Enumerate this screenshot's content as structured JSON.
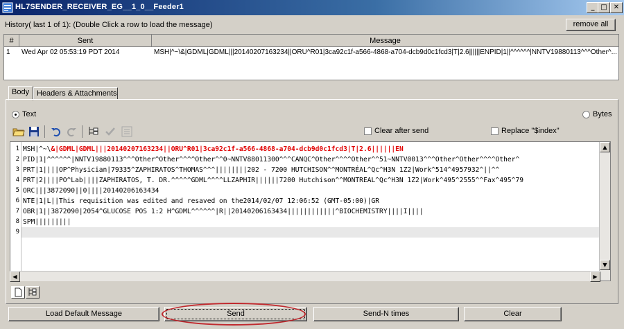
{
  "window": {
    "title": "HL7SENDER_RECEIVER_EG__1_0__Feeder1",
    "minimize": "_",
    "maximize": "□",
    "close": "✕"
  },
  "history": {
    "label": "History( last 1 of 1):   (Double Click a row to load the message)",
    "remove_all": "remove all",
    "columns": [
      "#",
      "Sent",
      "Message"
    ],
    "rows": [
      {
        "num": "1",
        "sent": "Wed Apr 02 05:53:19 PDT 2014",
        "message": "MSH|^~\\&|GDML|GDML|||20140207163234||ORU^R01|3ca92c1f-a566-4868-a704-dcb9d0c1fcd3|T|2.6||||||ENPID|1||^^^^^^|NNTV19880113^^^Other^..."
      }
    ]
  },
  "tabs": [
    {
      "label": "Body"
    },
    {
      "label": "Headers & Attachments"
    }
  ],
  "format": {
    "text_label": "Text",
    "bytes_label": "Bytes",
    "selected": "Text"
  },
  "toolbar": {
    "clear_after_send": "Clear after send",
    "replace_index": "Replace \"$index\"",
    "icons": [
      "open-folder-icon",
      "save-icon",
      "undo-icon",
      "redo-icon",
      "tree-view-icon",
      "validate-check-icon",
      "xml-icon"
    ]
  },
  "editor": {
    "line_numbers": [
      "1",
      "2",
      "3",
      "4",
      "5",
      "6",
      "7",
      "8",
      "9"
    ],
    "line1_prefix": "MSH|^~\\",
    "line1_highlight": "&|GDML|GDML|||20140207163234||ORU^R01|3ca92c1f-a566-4868-a704-dcb9d0c1fcd3|T|2.6||||||EN",
    "lines": [
      "PID|1|^^^^^^|NNTV19880113^^^Other^Other^^^^Other^^0~NNTV88011300^^^CANQC^Other^^^^Other^^51~NNTV0013^^^Other^Other^^^^Other^",
      "PRT|1||||OP^Physician|79335^ZAPHIRATOS^THOMAS^^^||||||||202 - 7200 HUTCHISON^^MONTRÉAL^Qc^H3N 1Z2|Work^514^4957932^||^^",
      "PRT|2||||PO^Lab||||ZAPHIRATOS, T. DR.^^^^^GDML^^^^LLZAPHIR||||||7200 Hutchison^^MONTREAL^Qc^H3N 1Z2|Work^495^2555^^Fax^495^79",
      "ORC|||3872090||0||||20140206163434",
      "NTE|1|L||This requisition was edited and resaved on the2014/02/07 12:06:52 (GMT-05:00)|GR",
      "OBR|1||3872090|2054^GLUCOSE POS 1:2 H^GDML^^^^^^|R||20140206163434||||||||||||^BIOCHEMISTRY||||I||||",
      "SPM|||||||||",
      ""
    ]
  },
  "buttons": {
    "load_default": "Load Default Message",
    "send": "Send",
    "send_n": "Send-N times",
    "clear": "Clear"
  },
  "colors": {
    "highlight": "#e00000",
    "title_bar": "#0a246a",
    "annotation_oval": "#c0292e"
  }
}
